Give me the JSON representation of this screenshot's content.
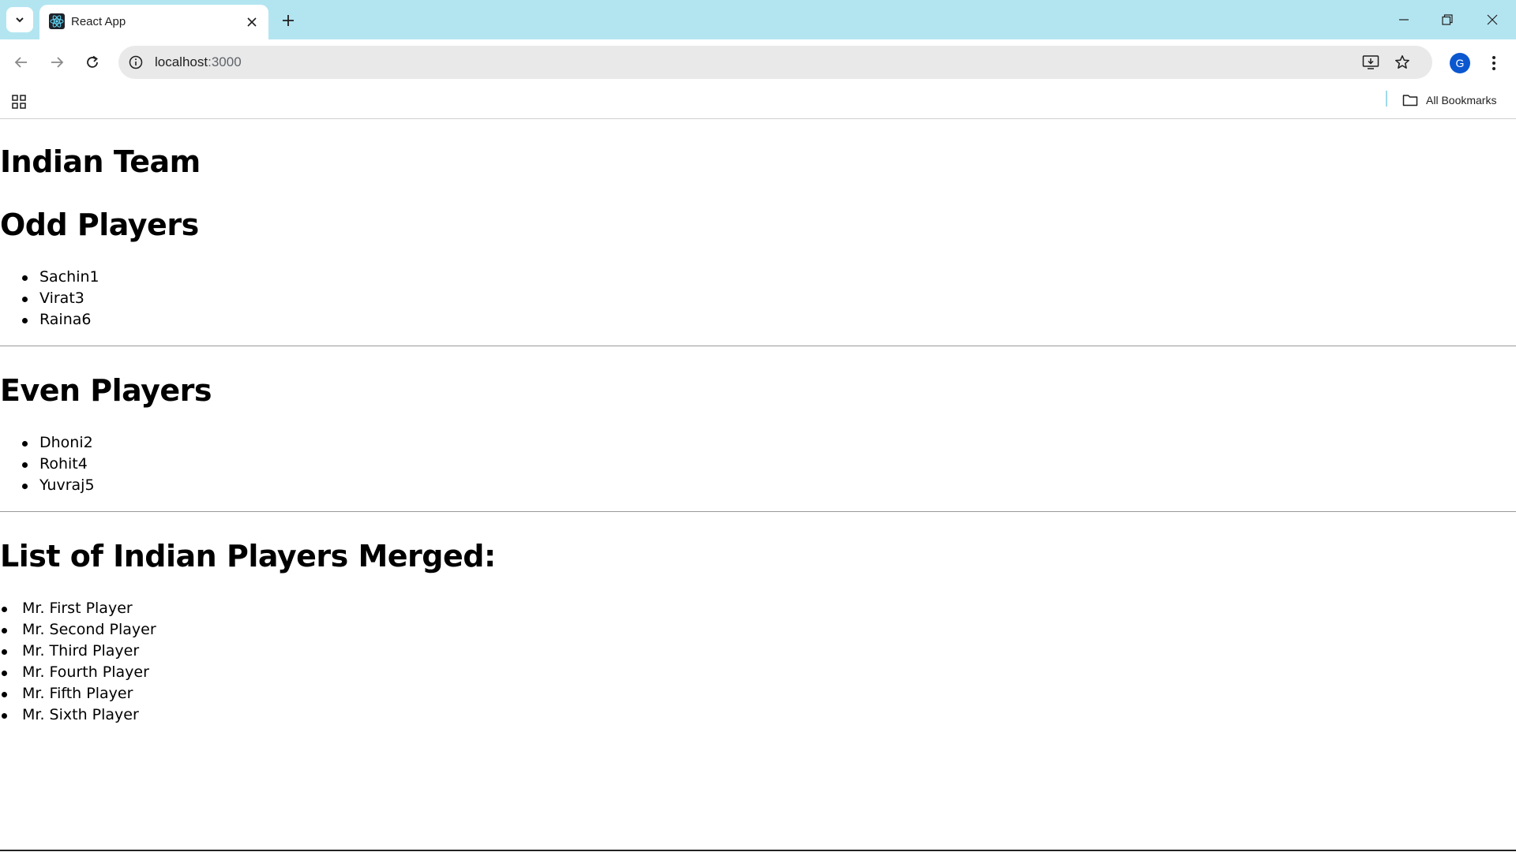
{
  "browser": {
    "tab_title": "React App",
    "url_host": "localhost",
    "url_port": ":3000",
    "avatar_letter": "G",
    "bookmarks_label": "All Bookmarks"
  },
  "page": {
    "title": "Indian Team",
    "odd_heading": "Odd Players",
    "odd_players": [
      "Sachin1",
      "Virat3",
      "Raina6"
    ],
    "even_heading": "Even Players",
    "even_players": [
      "Dhoni2",
      "Rohit4",
      "Yuvraj5"
    ],
    "merged_heading": "List of Indian Players Merged:",
    "merged_players": [
      "Mr. First Player",
      "Mr. Second Player",
      "Mr. Third Player",
      "Mr. Fourth Player",
      "Mr. Fifth Player",
      "Mr. Sixth Player"
    ]
  },
  "colors": {
    "tabstrip": "#b3e5f1",
    "avatar": "#0b57d0"
  }
}
